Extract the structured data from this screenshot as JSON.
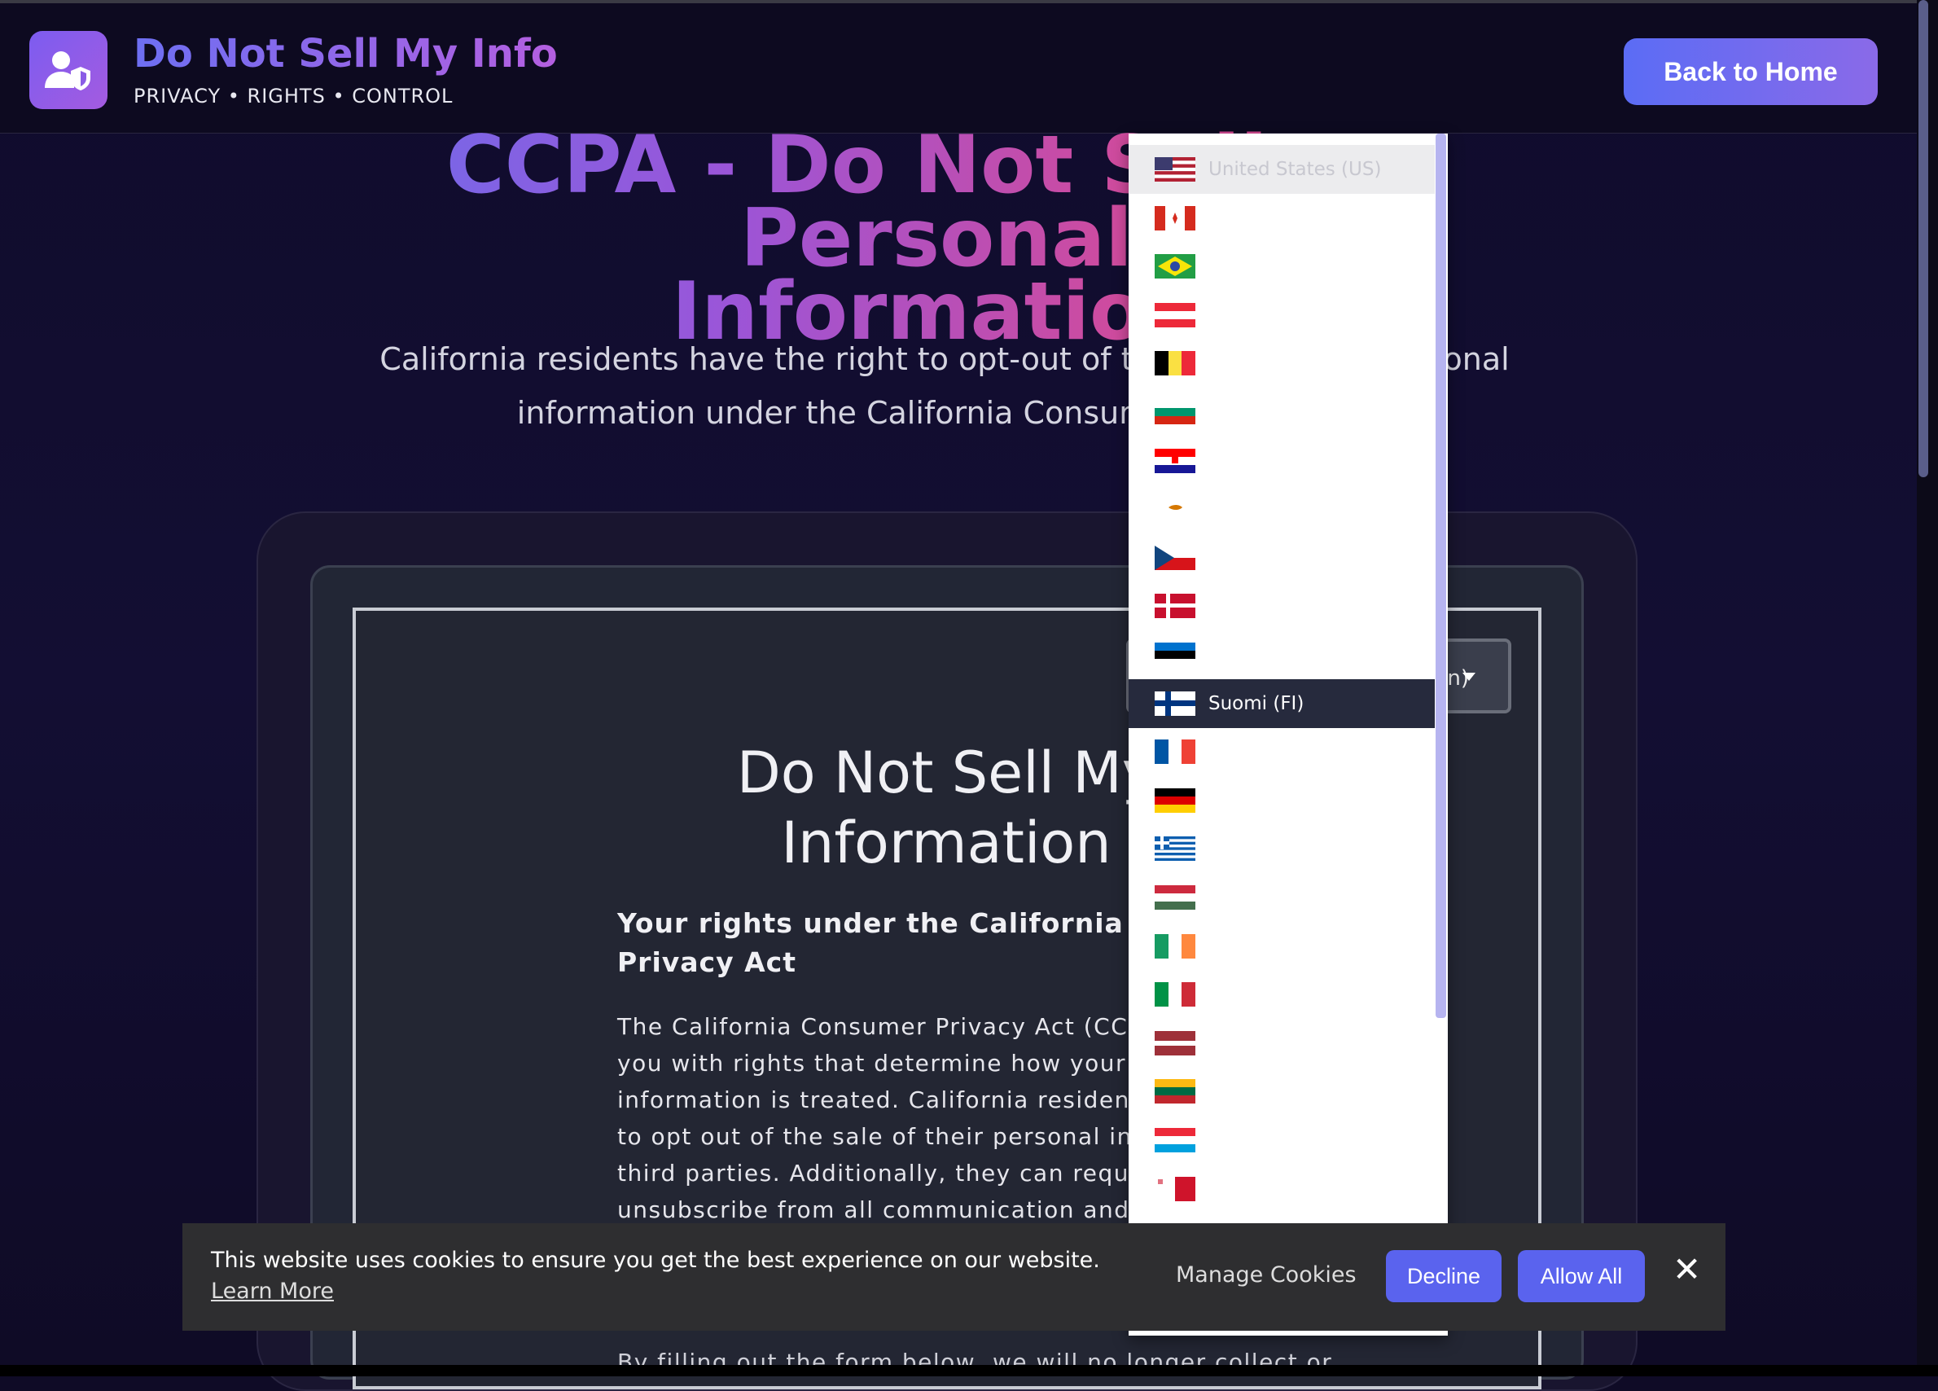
{
  "header": {
    "brand_title": "Do Not Sell My Info",
    "brand_subtitle": "PRIVACY • RIGHTS • CONTROL",
    "home_button": "Back to Home"
  },
  "hero": {
    "title_line1": "CCPA - Do Not Sell My Personal",
    "title_line2": "Information",
    "description": "California residents have the right to opt-out of the sale of their personal information under the California Consumer Privacy Act."
  },
  "form": {
    "language_value": "(en)",
    "title_line1": "Do Not Sell My",
    "title_line2": "Information",
    "rights_heading": "Your rights under the California Consumer Privacy Act",
    "body_lines": [
      "The California Consumer Privacy Act (CCPA",
      "you with rights that determine how your per",
      "information is treated. California residents c",
      "to opt out of the sale of their personal infor",
      "third parties. Additionally, they can request",
      "unsubscribe from all communication and as"
    ],
    "bottom_line": "By filling out the form below, we will no longer collect or"
  },
  "dropdown": {
    "options": [
      {
        "code": "us",
        "label": "United States (US)",
        "state": "top"
      },
      {
        "code": "ca",
        "label": ""
      },
      {
        "code": "br",
        "label": ""
      },
      {
        "code": "at",
        "label": ""
      },
      {
        "code": "be",
        "label": ""
      },
      {
        "code": "bg",
        "label": ""
      },
      {
        "code": "hr",
        "label": ""
      },
      {
        "code": "cy",
        "label": ""
      },
      {
        "code": "cz",
        "label": ""
      },
      {
        "code": "dk",
        "label": ""
      },
      {
        "code": "ee",
        "label": ""
      },
      {
        "code": "fi",
        "label": "Suomi (FI)",
        "state": "active"
      },
      {
        "code": "fr",
        "label": ""
      },
      {
        "code": "de",
        "label": ""
      },
      {
        "code": "gr",
        "label": ""
      },
      {
        "code": "hu",
        "label": ""
      },
      {
        "code": "ie",
        "label": ""
      },
      {
        "code": "it",
        "label": ""
      },
      {
        "code": "lv",
        "label": ""
      },
      {
        "code": "lt",
        "label": ""
      },
      {
        "code": "lu",
        "label": ""
      },
      {
        "code": "mt",
        "label": ""
      }
    ]
  },
  "cookie": {
    "message": "This website uses cookies to ensure you get the best experience on our website.",
    "learn_more": "Learn More",
    "manage": "Manage Cookies",
    "decline": "Decline",
    "allow_all": "Allow All",
    "close_icon": "close-icon"
  },
  "colors": {
    "accent": "#5b63ee",
    "background": "#110d2d",
    "active_option": "#262a3d"
  }
}
